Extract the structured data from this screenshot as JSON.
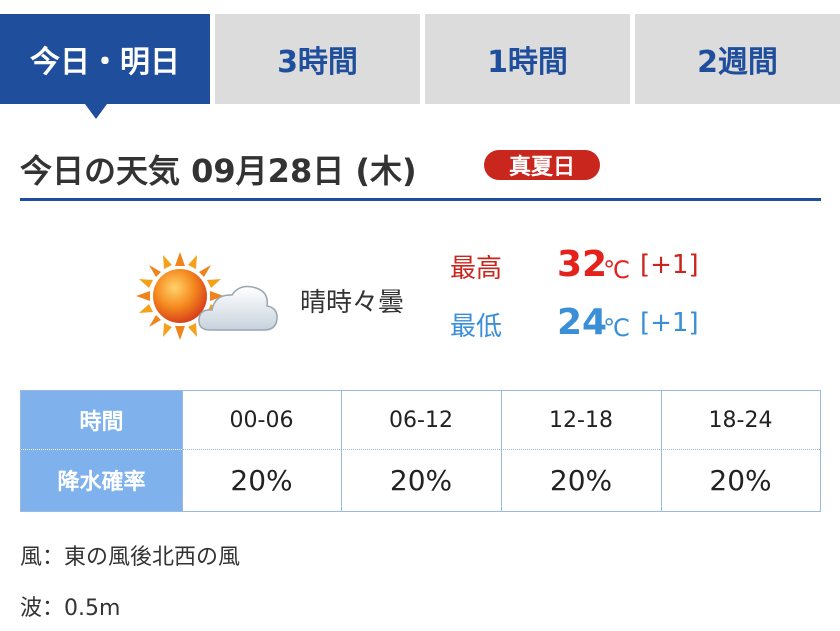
{
  "tabs": [
    {
      "label": "今日・明日",
      "active": true
    },
    {
      "label": "3時間",
      "active": false
    },
    {
      "label": "1時間",
      "active": false
    },
    {
      "label": "2週間",
      "active": false
    }
  ],
  "header": {
    "title": "今日の天気 09月28日 (木)",
    "badge": "真夏日"
  },
  "weather": {
    "icon": "sunny-then-cloudy-icon",
    "condition": "晴時々曇",
    "high_label": "最高",
    "high_value": "32",
    "high_unit": "℃",
    "high_diff": "[+1]",
    "low_label": "最低",
    "low_value": "24",
    "low_unit": "℃",
    "low_diff": "[+1]"
  },
  "precip_table": {
    "time_header": "時間",
    "precip_header": "降水確率",
    "times": [
      "00-06",
      "06-12",
      "12-18",
      "18-24"
    ],
    "values": [
      "20%",
      "20%",
      "20%",
      "20%"
    ]
  },
  "info": {
    "wind": "風：東の風後北西の風",
    "wave": "波：0.5m"
  },
  "colors": {
    "accent": "#1f4f9c",
    "tab_inactive": "#dcdcdc",
    "badge": "#c9261e",
    "high": "#e5211b",
    "low": "#3a8fd6",
    "table_header": "#7fb2ec"
  }
}
